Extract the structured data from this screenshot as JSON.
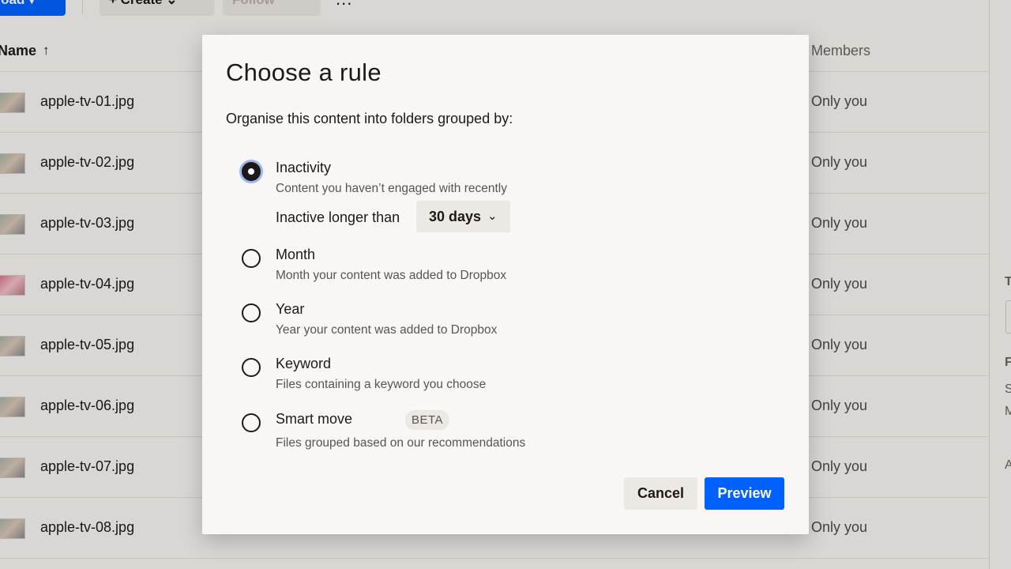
{
  "toolbar": {
    "upload_label": "pload ▾",
    "create_label": "+ Create ⌄",
    "follow_label": "Follow",
    "more_label": "..."
  },
  "table": {
    "header_name": "Name",
    "header_members": "Members",
    "sort_icon": "arrow-up-icon",
    "rows": [
      {
        "name": "apple-tv-01.jpg",
        "members": "Only you"
      },
      {
        "name": "apple-tv-02.jpg",
        "members": "Only you"
      },
      {
        "name": "apple-tv-03.jpg",
        "members": "Only you"
      },
      {
        "name": "apple-tv-04.jpg",
        "members": "Only you"
      },
      {
        "name": "apple-tv-05.jpg",
        "members": "Only you"
      },
      {
        "name": "apple-tv-06.jpg",
        "members": "Only you"
      },
      {
        "name": "apple-tv-07.jpg",
        "members": "Only you"
      },
      {
        "name": "apple-tv-08.jpg",
        "members": "Only you"
      }
    ]
  },
  "sidepanel": {
    "frag1": "T",
    "frag2": "F",
    "frag3": "S",
    "frag4": "M",
    "frag5": "A"
  },
  "modal": {
    "title": "Choose a rule",
    "subtitle": "Organise this content into folders grouped by:",
    "options": [
      {
        "label": "Inactivity",
        "desc": "Content you haven’t engaged with recently",
        "selected": true
      },
      {
        "label": "Month",
        "desc": "Month your content was added to Dropbox",
        "selected": false
      },
      {
        "label": "Year",
        "desc": "Year your content was added to Dropbox",
        "selected": false
      },
      {
        "label": "Keyword",
        "desc": "Files containing a keyword you choose",
        "selected": false
      },
      {
        "label": "Smart move",
        "badge": "BETA",
        "desc": "Files grouped based on our recommendations",
        "selected": false
      }
    ],
    "inactive_label": "Inactive longer than",
    "inactive_value": "30 days",
    "cancel_label": "Cancel",
    "preview_label": "Preview"
  },
  "colors": {
    "accent": "#0061fe",
    "background": "#f7f5f2",
    "modal_bg": "#f9f7f5",
    "neutral_button": "#ece8e3",
    "radio_focus": "#9cb8f1"
  }
}
